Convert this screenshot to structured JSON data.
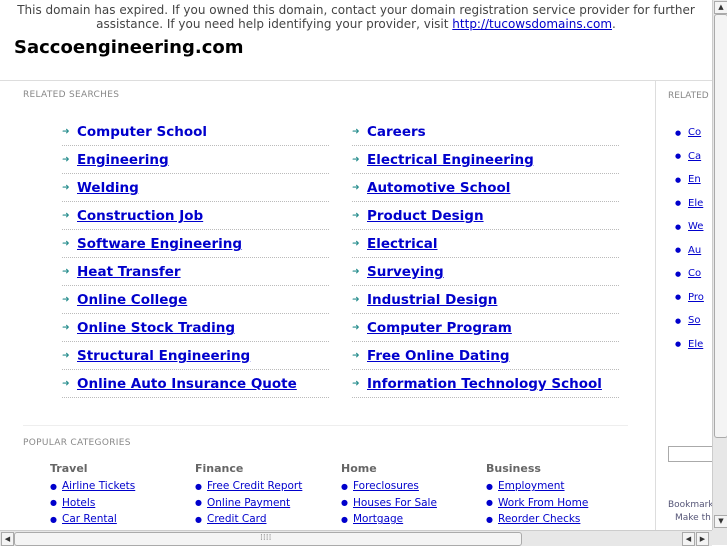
{
  "notice": {
    "line1": "This domain has expired. If you owned this domain, contact your domain registration service provider for further",
    "line2_pre": "assistance. If you need help identifying your provider, visit ",
    "link": "http://tucowsdomains.com",
    "line2_post": "."
  },
  "domain_title": "Saccoengineering.com",
  "related_searches": {
    "title": "RELATED SEARCHES",
    "left": [
      "Computer School",
      "Engineering",
      "Welding",
      "Construction Job",
      "Software Engineering",
      "Heat Transfer",
      "Online College",
      "Online Stock Trading",
      "Structural Engineering",
      "Online Auto Insurance Quote"
    ],
    "right": [
      "Careers",
      "Electrical Engineering",
      "Automotive School",
      "Product Design",
      "Electrical",
      "Surveying",
      "Industrial Design",
      "Computer Program",
      "Free Online Dating",
      "Information Technology School"
    ]
  },
  "popular_categories": {
    "title": "POPULAR CATEGORIES",
    "categories": [
      {
        "name": "Travel",
        "items": [
          "Airline Tickets",
          "Hotels",
          "Car Rental"
        ]
      },
      {
        "name": "Finance",
        "items": [
          "Free Credit Report",
          "Online Payment",
          "Credit Card"
        ]
      },
      {
        "name": "Home",
        "items": [
          "Foreclosures",
          "Houses For Sale",
          "Mortgage"
        ]
      },
      {
        "name": "Business",
        "items": [
          "Employment",
          "Work From Home",
          "Reorder Checks"
        ]
      }
    ]
  },
  "sidebar": {
    "title": "RELATED",
    "items": [
      "Co",
      "Ca",
      "En",
      "Ele",
      "We",
      "Au",
      "Co",
      "Pro",
      "So",
      "Ele"
    ],
    "footer_line1": "Bookmark",
    "footer_line2": "Make th"
  },
  "colors": {
    "link": "#0000cc",
    "arrow": "#2a8f8f"
  }
}
